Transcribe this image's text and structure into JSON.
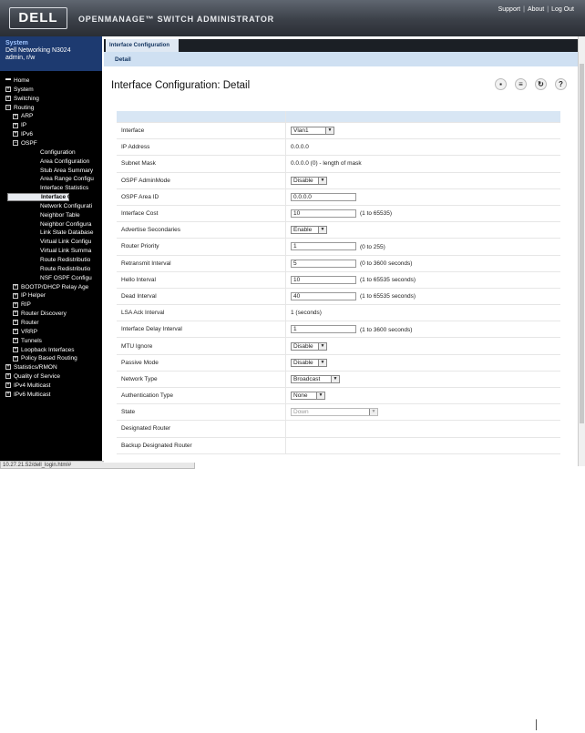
{
  "header": {
    "logo": "DELL",
    "app_title": "OPENMANAGE™ SWITCH ADMINISTRATOR",
    "links": [
      "Support",
      "About",
      "Log Out"
    ]
  },
  "system": {
    "label": "System",
    "model": "Dell Networking N3024",
    "user": "admin, r/w"
  },
  "nav": [
    {
      "label": "Home",
      "box": "",
      "level": 0
    },
    {
      "label": "System",
      "box": "+",
      "level": 0
    },
    {
      "label": "Switching",
      "box": "+",
      "level": 0
    },
    {
      "label": "Routing",
      "box": "−",
      "level": 0
    },
    {
      "label": "ARP",
      "box": "+",
      "level": 1
    },
    {
      "label": "IP",
      "box": "+",
      "level": 1
    },
    {
      "label": "IPv6",
      "box": "+",
      "level": 1
    },
    {
      "label": "OSPF",
      "box": "−",
      "level": 1
    },
    {
      "label": "Configuration",
      "box": "",
      "level": 2
    },
    {
      "label": "Area Configuration",
      "box": "",
      "level": 2
    },
    {
      "label": "Stub Area Summary",
      "box": "",
      "level": 2
    },
    {
      "label": "Area Range Configu",
      "box": "",
      "level": 2
    },
    {
      "label": "Interface Statistics",
      "box": "",
      "level": 2
    },
    {
      "label": "Interface Configu",
      "box": "",
      "level": 2,
      "selected": true
    },
    {
      "label": "Network Configurati",
      "box": "",
      "level": 2
    },
    {
      "label": "Neighbor Table",
      "box": "",
      "level": 2
    },
    {
      "label": "Neighbor Configura",
      "box": "",
      "level": 2
    },
    {
      "label": "Link State Database",
      "box": "",
      "level": 2
    },
    {
      "label": "Virtual Link Configu",
      "box": "",
      "level": 2
    },
    {
      "label": "Virtual Link Summa",
      "box": "",
      "level": 2
    },
    {
      "label": "Route Redistributio",
      "box": "",
      "level": 2
    },
    {
      "label": "Route Redistributio",
      "box": "",
      "level": 2
    },
    {
      "label": "NSF OSPF Configu",
      "box": "",
      "level": 2
    },
    {
      "label": "BOOTP/DHCP Relay Age",
      "box": "+",
      "level": 1
    },
    {
      "label": "IP Helper",
      "box": "+",
      "level": 1
    },
    {
      "label": "RIP",
      "box": "+",
      "level": 1
    },
    {
      "label": "Router Discovery",
      "box": "+",
      "level": 1
    },
    {
      "label": "Router",
      "box": "+",
      "level": 1
    },
    {
      "label": "VRRP",
      "box": "+",
      "level": 1
    },
    {
      "label": "Tunnels",
      "box": "+",
      "level": 1
    },
    {
      "label": "Loopback Interfaces",
      "box": "+",
      "level": 1
    },
    {
      "label": "Policy Based Routing",
      "box": "+",
      "level": 1
    },
    {
      "label": "Statistics/RMON",
      "box": "+",
      "level": 0
    },
    {
      "label": "Quality of Service",
      "box": "+",
      "level": 0
    },
    {
      "label": "IPv4 Multicast",
      "box": "+",
      "level": 0
    },
    {
      "label": "IPv6 Multicast",
      "box": "+",
      "level": 0
    }
  ],
  "status_url": "10.27.21.52/dell_login.html#",
  "tabs": {
    "main": "Interface Configuration",
    "sub": "Detail"
  },
  "page_title": "Interface Configuration: Detail",
  "rows": [
    {
      "label": "Interface",
      "kind": "select",
      "value": "Vlan1",
      "w": 48
    },
    {
      "label": "IP Address",
      "kind": "text",
      "value": "0.0.0.0"
    },
    {
      "label": "Subnet Mask",
      "kind": "text",
      "value": "0.0.0.0  (0) - length of mask"
    },
    {
      "label": "OSPF AdminMode",
      "kind": "select",
      "value": "Disable",
      "w": 40
    },
    {
      "label": "OSPF Area ID",
      "kind": "input",
      "value": "0.0.0.0"
    },
    {
      "label": "Interface Cost",
      "kind": "input",
      "value": "10",
      "hint": "(1 to 65535)"
    },
    {
      "label": "Advertise Secondaries",
      "kind": "select",
      "value": "Enable",
      "w": 40
    },
    {
      "label": "Router Priority",
      "kind": "input",
      "value": "1",
      "hint": "(0 to 255)"
    },
    {
      "label": "Retransmit Interval",
      "kind": "input",
      "value": "5",
      "hint": "(0 to 3600 seconds)"
    },
    {
      "label": "Hello Interval",
      "kind": "input",
      "value": "10",
      "hint": "(1 to 65535 seconds)"
    },
    {
      "label": "Dead Interval",
      "kind": "input",
      "value": "40",
      "hint": "(1 to 65535 seconds)"
    },
    {
      "label": "LSA Ack Interval",
      "kind": "text",
      "value": "1  (seconds)"
    },
    {
      "label": "Interface Delay Interval",
      "kind": "input",
      "value": "1",
      "hint": "(1 to 3600 seconds)"
    },
    {
      "label": "MTU Ignore",
      "kind": "select",
      "value": "Disable",
      "w": 40
    },
    {
      "label": "Passive Mode",
      "kind": "select",
      "value": "Disable",
      "w": 40
    },
    {
      "label": "Network Type",
      "kind": "select",
      "value": "Broadcast",
      "w": 54
    },
    {
      "label": "Authentication Type",
      "kind": "select",
      "value": "None",
      "w": 38
    },
    {
      "label": "State",
      "kind": "select-disabled",
      "value": "Down",
      "w": 96
    },
    {
      "label": "Designated Router",
      "kind": "text",
      "value": ""
    },
    {
      "label": "Backup Designated Router",
      "kind": "text",
      "value": ""
    }
  ]
}
